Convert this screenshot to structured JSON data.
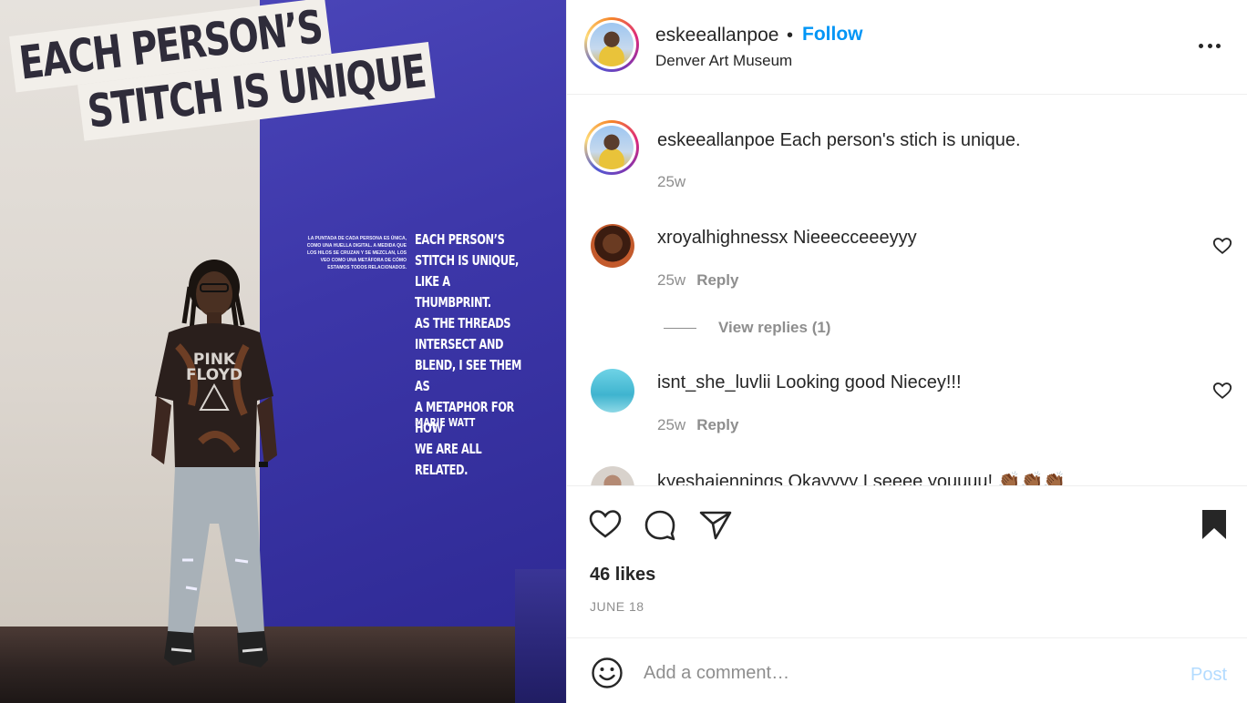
{
  "post_image": {
    "headline_line1": "EACH PERSON’S",
    "headline_line2": "STITCH IS UNIQUE",
    "spanish_text": "La puntada de cada persona es única, como una huella digital. A medida que los hilos se cruzan y se mezclan, los veo como una metáfora de cómo estamos todos relacionados.",
    "quote": "EACH PERSON’S\nSTITCH IS UNIQUE,\nLIKE A THUMBPRINT.\nAS THE THREADS\nINTERSECT AND\nBLEND, I SEE THEM AS\nA METAPHOR FOR HOW\nWE ARE ALL RELATED.",
    "author": "MARIE WATT"
  },
  "header": {
    "username": "eskeeallanpoe",
    "separator": "•",
    "follow_label": "Follow",
    "location": "Denver Art Museum"
  },
  "caption": {
    "username": "eskeeallanpoe",
    "text": "Each person's stich is unique.",
    "age": "25w"
  },
  "comments": [
    {
      "username": "xroyalhighnessx",
      "text": "Nieeecceeeyyy",
      "age": "25w",
      "reply_label": "Reply",
      "view_replies": "View replies (1)"
    },
    {
      "username": "isnt_she_luvlii",
      "text": "Looking good Niecey!!!",
      "age": "25w",
      "reply_label": "Reply"
    },
    {
      "username": "kyeshajennings",
      "text": "Okayyyy I seeee youuuu! 👏🏾👏🏾👏🏾"
    }
  ],
  "likes": "46 likes",
  "date": "JUNE 18",
  "composer": {
    "placeholder": "Add a comment…",
    "post_label": "Post"
  },
  "colors": {
    "follow": "#0095f6",
    "post_disabled": "#b3dbff",
    "secondary_text": "#8e8e8e"
  },
  "icons": [
    "heart-icon",
    "comment-icon",
    "share-icon",
    "bookmark-icon",
    "more-icon",
    "emoji-icon"
  ]
}
